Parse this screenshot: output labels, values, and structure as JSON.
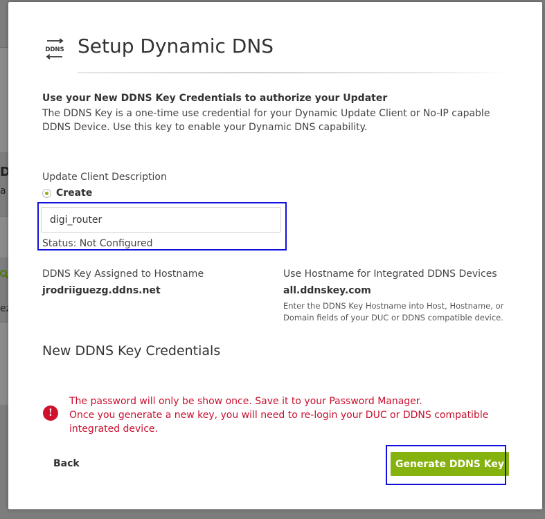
{
  "background": {
    "heading_fragment": "DN",
    "text_fragment_1": "a",
    "text_fragment_2": "ez"
  },
  "modal": {
    "icon_label": "DDNS",
    "title": "Setup Dynamic DNS",
    "intro_title": "Use your New DDNS Key Credentials to authorize your Updater",
    "intro_description": "The DDNS Key is a one-time use credential for your Dynamic Update Client or No-IP capable DDNS Device. Use this key to enable your Dynamic DNS capability.",
    "update_client": {
      "label": "Update Client Description",
      "option_label": "Create",
      "input_value": "digi_router",
      "status": "Status: Not Configured"
    },
    "assigned": {
      "label": "DDNS Key Assigned to Hostname",
      "value": "jrodriiguezg.ddns.net"
    },
    "integrated": {
      "label": "Use Hostname for Integrated DDNS Devices",
      "value": "all.ddnskey.com",
      "help": "Enter the DDNS Key Hostname into Host, Hostname, or Domain fields of your DUC or DDNS compatible device."
    },
    "credentials_title": "New DDNS Key Credentials",
    "alert": {
      "icon": "exclamation-icon",
      "line1": "The password will only be show once. Save it to your Password Manager.",
      "line2": "Once you generate a new key, you will need to re-login your DUC or DDNS compatible integrated device."
    },
    "back_label": "Back",
    "generate_label": "Generate DDNS Key"
  },
  "colors": {
    "accent_green": "#86b20f",
    "alert_red": "#c8102e",
    "highlight_blue": "#1010dd"
  }
}
